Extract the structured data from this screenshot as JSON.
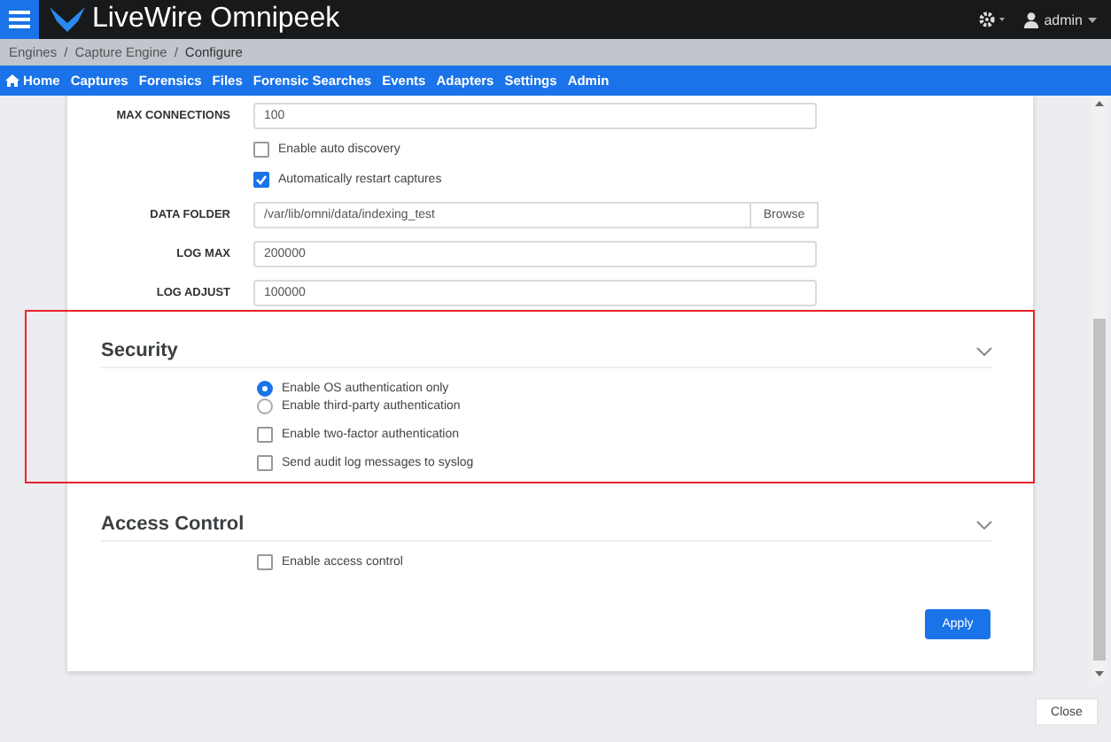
{
  "header": {
    "title": "LiveWire Omnipeek",
    "user": "admin"
  },
  "breadcrumb": {
    "separator": "/",
    "items": [
      "Engines",
      "Capture Engine",
      "Configure"
    ]
  },
  "nav": [
    {
      "label": "Home"
    },
    {
      "label": "Captures"
    },
    {
      "label": "Forensics"
    },
    {
      "label": "Files"
    },
    {
      "label": "Forensic Searches"
    },
    {
      "label": "Events"
    },
    {
      "label": "Adapters"
    },
    {
      "label": "Settings"
    },
    {
      "label": "Admin"
    }
  ],
  "settings": [
    {
      "kind": "field",
      "label": "MAX CONNECTIONS",
      "value": "100"
    },
    {
      "kind": "checkbox",
      "label": "Enable auto discovery",
      "checked": false
    },
    {
      "kind": "checkbox",
      "label": "Automatically restart captures",
      "checked": true
    },
    {
      "kind": "folder",
      "label": "DATA FOLDER",
      "value": "/var/lib/omni/data/indexing_test",
      "button": "Browse"
    },
    {
      "kind": "field",
      "label": "LOG MAX",
      "value": "200000"
    },
    {
      "kind": "field",
      "label": "LOG ADJUST",
      "value": "100000"
    }
  ],
  "sections": [
    {
      "title": "Security",
      "highlighted": true,
      "options": [
        {
          "kind": "radio",
          "label": "Enable OS authentication only",
          "selected": true
        },
        {
          "kind": "radio",
          "label": "Enable third-party authentication",
          "selected": false
        },
        {
          "kind": "checkbox",
          "label": "Enable two-factor authentication",
          "checked": false
        },
        {
          "kind": "checkbox",
          "label": "Send audit log messages to syslog",
          "checked": false
        }
      ]
    },
    {
      "title": "Access Control",
      "highlighted": false,
      "options": [
        {
          "kind": "checkbox",
          "label": "Enable access control",
          "checked": false
        }
      ]
    }
  ],
  "apply_button": "Apply",
  "close_button": "Close"
}
